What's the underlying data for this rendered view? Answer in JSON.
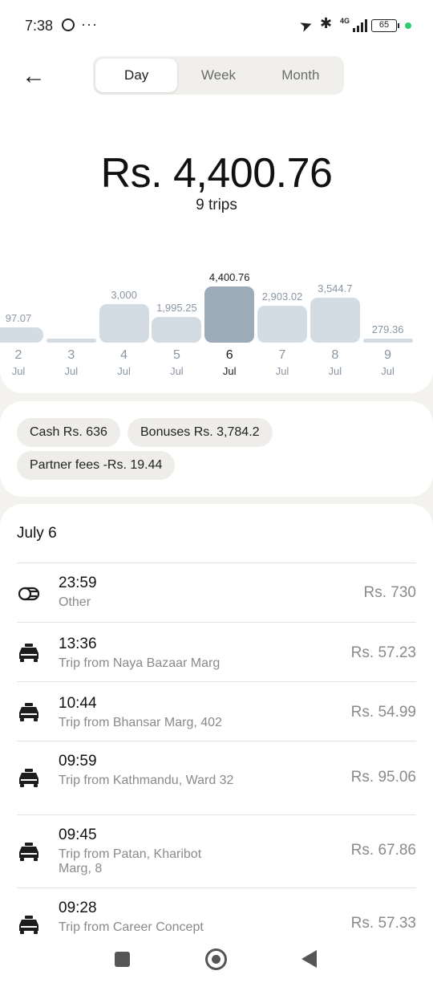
{
  "status_bar": {
    "time": "7:38",
    "network": "4G",
    "battery": "65"
  },
  "tabs": [
    {
      "label": "Day",
      "active": true
    },
    {
      "label": "Week",
      "active": false
    },
    {
      "label": "Month",
      "active": false
    }
  ],
  "summary": {
    "total": "Rs. 4,400.76",
    "trips": "9 trips"
  },
  "chart_data": {
    "type": "bar",
    "categories": [
      "2 Jul",
      "3 Jul",
      "4 Jul",
      "5 Jul",
      "6 Jul",
      "7 Jul",
      "8 Jul",
      "9 Jul"
    ],
    "days": [
      "2",
      "3",
      "4",
      "5",
      "6",
      "7",
      "8",
      "9"
    ],
    "month": "Jul",
    "labels": [
      "97.07",
      "",
      "3,000",
      "1,995.25",
      "4,400.76",
      "2,903.02",
      "3,544.7",
      "279.36"
    ],
    "values": [
      1197.07,
      0,
      3000,
      1995.25,
      4400.76,
      2903.02,
      3544.7,
      279.36
    ],
    "selected_index": 4,
    "colors": {
      "bar": "#d3dbe3",
      "selected": "#9daab7",
      "label": "#8a96a3"
    }
  },
  "chips": [
    "Cash Rs. 636",
    "Bonuses Rs. 3,784.2",
    "Partner fees -Rs. 19.44"
  ],
  "list": {
    "title": "July 6",
    "items": [
      {
        "icon": "coins-icon",
        "time": "23:59",
        "desc": "Other",
        "amount": "Rs. 730"
      },
      {
        "icon": "car-icon",
        "time": "13:36",
        "desc": "Trip from Naya Bazaar Marg",
        "amount": "Rs. 57.23"
      },
      {
        "icon": "car-icon",
        "time": "10:44",
        "desc": "Trip from Bhansar Marg, 402",
        "amount": "Rs. 54.99"
      },
      {
        "icon": "car-icon",
        "time": "09:59",
        "desc": "Trip from Kathmandu, Ward 32",
        "amount": "Rs. 95.06"
      },
      {
        "icon": "car-icon",
        "time": "09:45",
        "desc": "Trip from Patan, Kharibot Marg, 8",
        "amount": "Rs. 67.86"
      },
      {
        "icon": "car-icon",
        "time": "09:28",
        "desc": "Trip from Career Concept",
        "amount": "Rs. 57.33"
      }
    ]
  }
}
